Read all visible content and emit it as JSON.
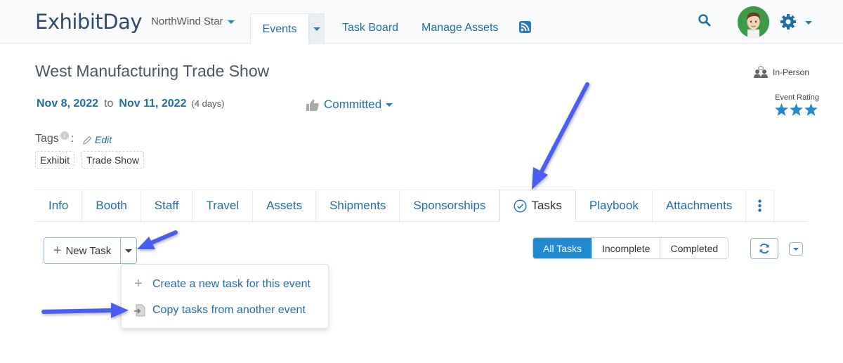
{
  "app": {
    "logo": "ExhibitDay",
    "org": "NorthWind Star"
  },
  "nav": {
    "events": "Events",
    "task_board": "Task Board",
    "manage_assets": "Manage Assets"
  },
  "event": {
    "title": "West Manufacturing Trade Show",
    "format": "In-Person",
    "start_date": "Nov 8, 2022",
    "to": "to",
    "end_date": "Nov 11, 2022",
    "duration": "(4 days)",
    "status": "Committed",
    "rating_label": "Event Rating",
    "rating": 3
  },
  "tags": {
    "label": "Tags",
    "info": "i",
    "colon": ":",
    "edit": "Edit",
    "items": [
      "Exhibit",
      "Trade Show"
    ]
  },
  "tabs": [
    "Info",
    "Booth",
    "Staff",
    "Travel",
    "Assets",
    "Shipments",
    "Sponsorships",
    "Tasks",
    "Playbook",
    "Attachments"
  ],
  "active_tab": "Tasks",
  "tasks": {
    "new_task": "New Task",
    "menu": [
      "Create a new task for this event",
      "Copy tasks from another event"
    ],
    "filters": [
      "All Tasks",
      "Incomplete",
      "Completed"
    ],
    "active_filter": "All Tasks"
  },
  "colors": {
    "accent": "#1f6fa6",
    "button": "#1f8ad0",
    "annotation_arrow": "#4a5ef0"
  }
}
